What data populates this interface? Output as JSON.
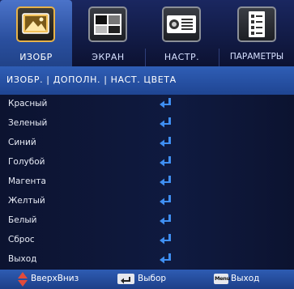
{
  "tabs": [
    {
      "label": "ИЗОБР",
      "icon": "picture-icon",
      "active": true
    },
    {
      "label": "ЭКРАН",
      "icon": "screen-icon",
      "active": false
    },
    {
      "label": "НАСТР.",
      "icon": "projector-icon",
      "active": false
    },
    {
      "label": "ПАРАМЕТРЫ",
      "icon": "options-icon",
      "active": false
    }
  ],
  "breadcrumb": "ИЗОБР. | ДОПОЛН. | НАСТ. ЦВЕТА",
  "menu_items": [
    {
      "label": "Красный",
      "icon": "enter-icon"
    },
    {
      "label": "Зеленый",
      "icon": "enter-icon"
    },
    {
      "label": "Синий",
      "icon": "enter-icon"
    },
    {
      "label": "Голубой",
      "icon": "enter-icon"
    },
    {
      "label": "Магента",
      "icon": "enter-icon"
    },
    {
      "label": "Желтый",
      "icon": "enter-icon"
    },
    {
      "label": "Белый",
      "icon": "enter-icon"
    },
    {
      "label": "Сброс",
      "icon": "enter-icon"
    },
    {
      "label": "Выход",
      "icon": "enter-icon"
    }
  ],
  "footer": {
    "updown_label": "ВверхВниз",
    "select_label": "Выбор",
    "menu_key": "Menu",
    "exit_label": "Выход"
  },
  "colors": {
    "accent": "#2f5eb6",
    "enter_icon": "#3f8ff2",
    "arrow_up": "#e14b3b"
  }
}
